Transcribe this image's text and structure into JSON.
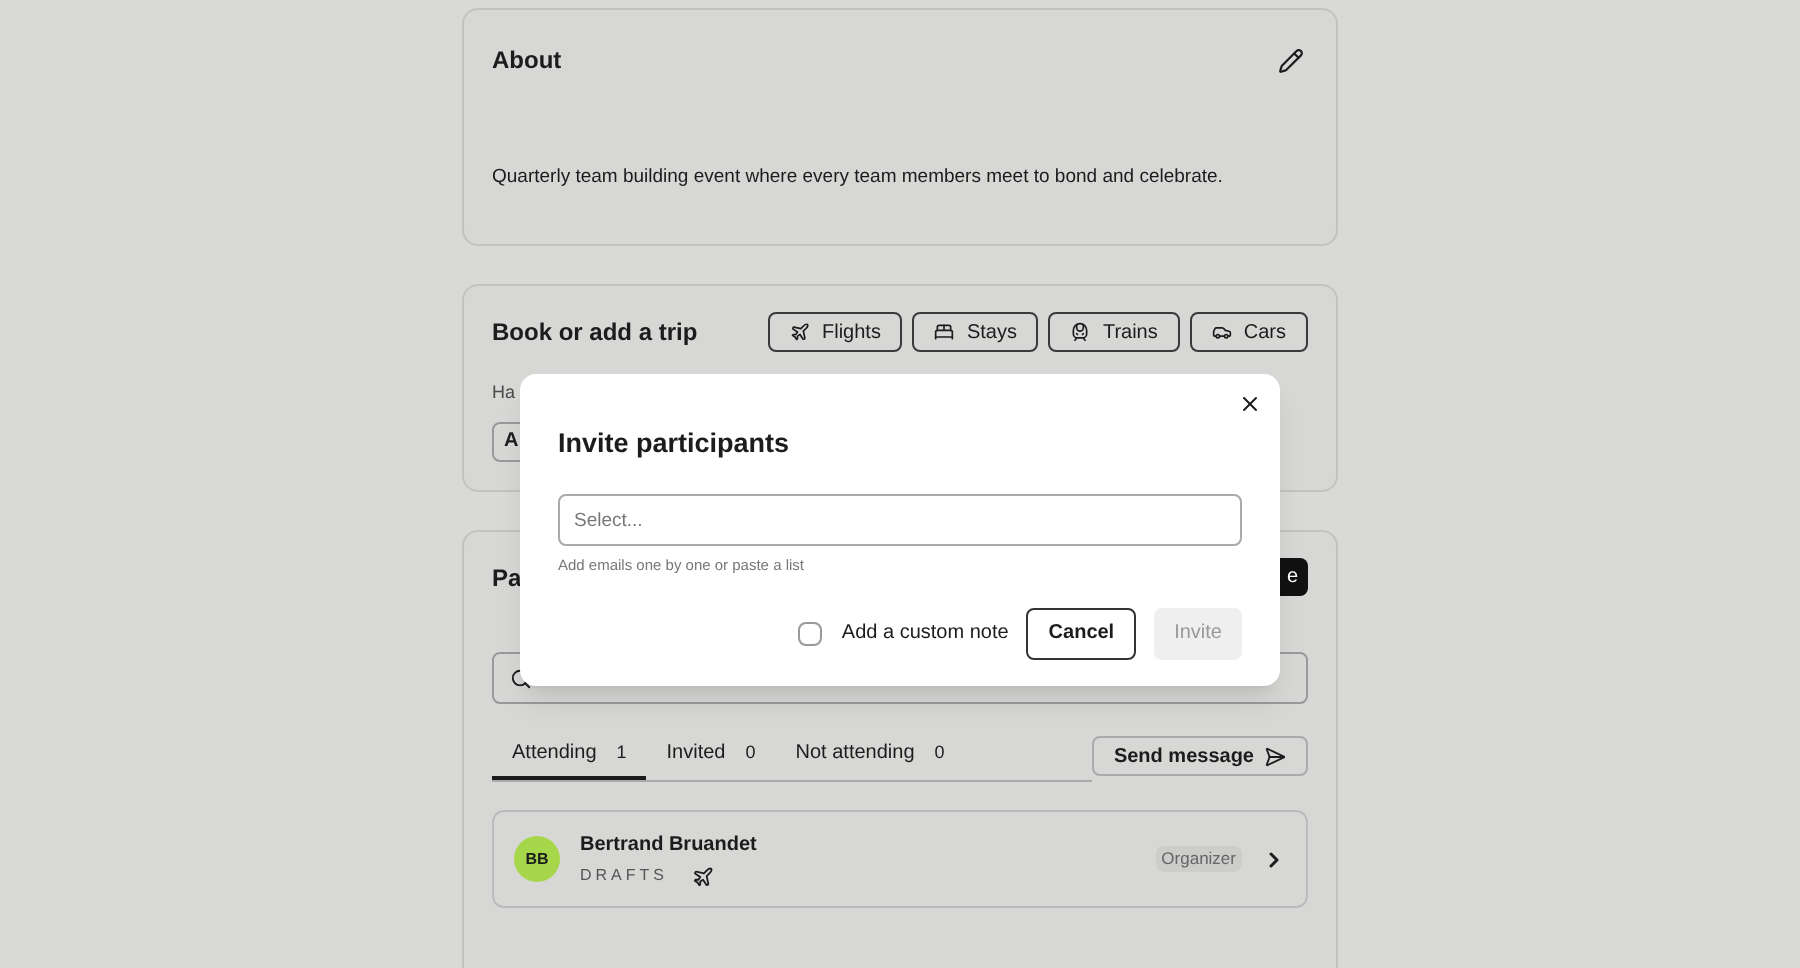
{
  "about": {
    "title": "About",
    "description": "Quarterly team building event where every team members meet to bond and celebrate."
  },
  "trip": {
    "title": "Book or add a trip",
    "options": [
      {
        "label": "Flights",
        "kind": "flight"
      },
      {
        "label": "Stays",
        "kind": "stay"
      },
      {
        "label": "Trains",
        "kind": "train"
      },
      {
        "label": "Cars",
        "kind": "car"
      }
    ],
    "hint_fragment": "Ha",
    "add_button_fragment": "A"
  },
  "participants": {
    "title_fragment": "Pa",
    "action_fragment": "e",
    "tabs": [
      {
        "label": "Attending",
        "count": "1",
        "selected": true
      },
      {
        "label": "Invited",
        "count": "0",
        "selected": false
      },
      {
        "label": "Not attending",
        "count": "0",
        "selected": false
      }
    ],
    "send_button": "Send message",
    "people": [
      {
        "initials": "BB",
        "name": "Bertrand Bruandet",
        "status": "DRAFTS",
        "role": "Organizer",
        "color": "#a6d74a"
      }
    ]
  },
  "dialog": {
    "title": "Invite participants",
    "field": {
      "placeholder": "Select..."
    },
    "hint": "Add emails one by one or paste a list",
    "note_checkbox": {
      "label": "Add a custom note",
      "checked": false
    },
    "cancel": "Cancel",
    "invite": {
      "label": "Invite",
      "disabled": true
    }
  }
}
